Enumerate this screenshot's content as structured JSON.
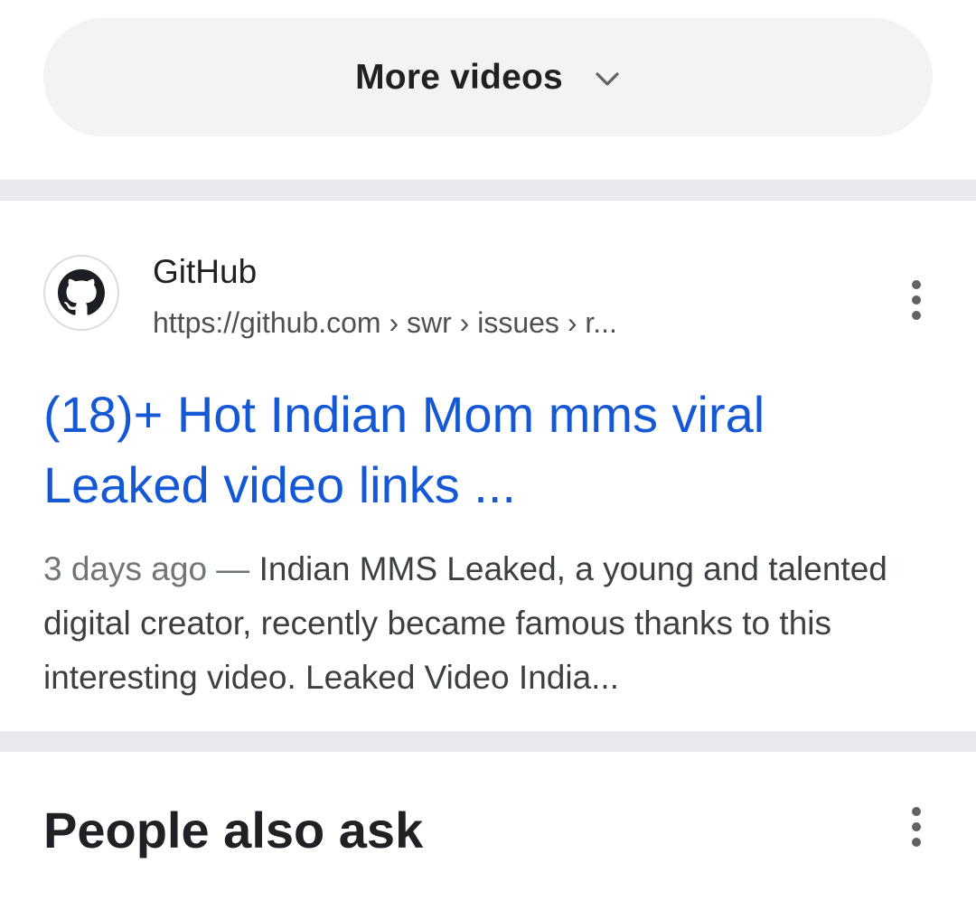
{
  "more_videos": {
    "label": "More videos",
    "icon": "chevron-down-icon"
  },
  "result": {
    "favicon": "github-icon",
    "site_name": "GitHub",
    "url": "https://github.com › swr › issues › r...",
    "title_line1": "(18)+ Hot Indian Mom mms viral",
    "title_line2": "Leaked video links ...",
    "snippet_date": "3 days ago",
    "snippet_separator": " — ",
    "snippet_text": "Indian MMS Leaked, a young and talented digital creator, recently became famous thanks to this interesting video. Leaked Video India...",
    "menu_icon": "more-vert-icon"
  },
  "people_also_ask": {
    "title": "People also ask",
    "menu_icon": "more-vert-icon"
  },
  "colors": {
    "link": "#1558d6",
    "pill_bg": "#f1f3f4",
    "separator": "#e8eaed",
    "text_primary": "#202124",
    "text_secondary": "#4d5156"
  }
}
